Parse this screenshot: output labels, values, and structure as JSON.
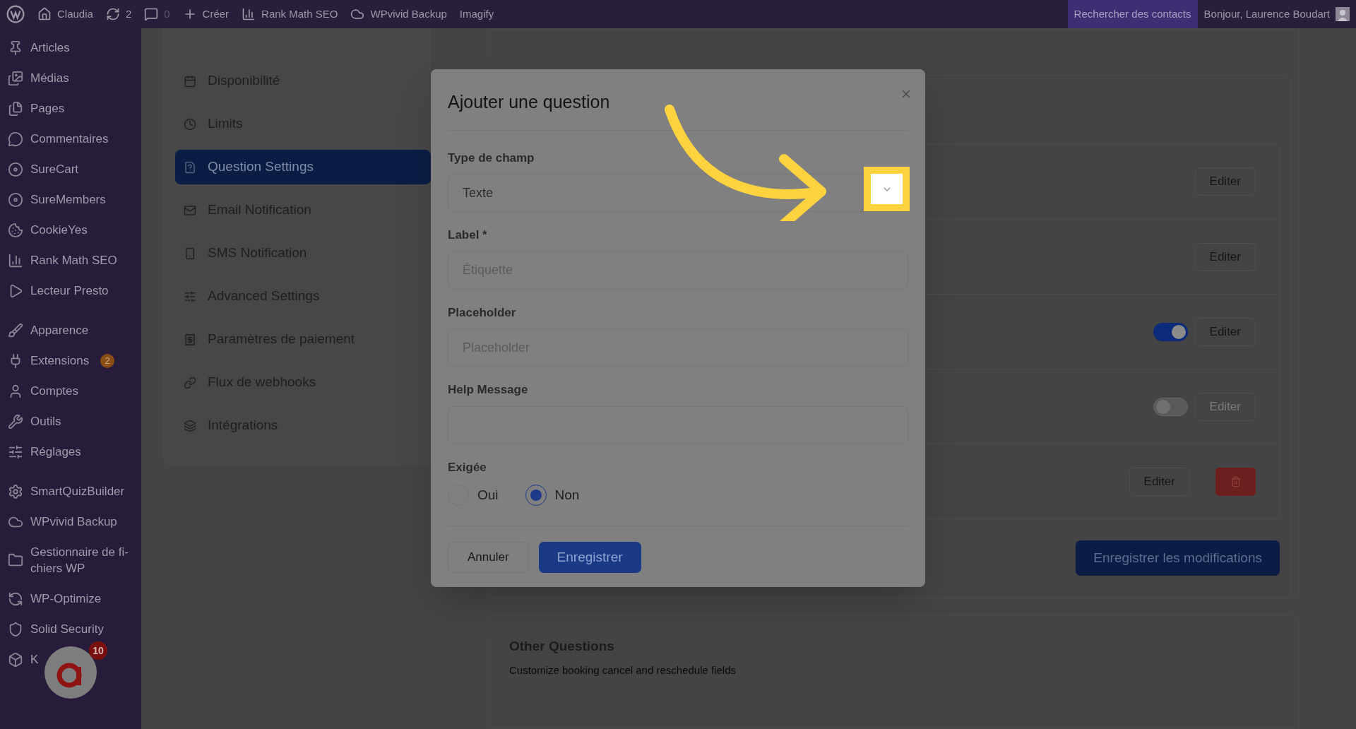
{
  "admin_bar": {
    "items": [
      {
        "label": "Claudia",
        "disabled": false
      },
      {
        "label": "2",
        "disabled": false
      },
      {
        "label": "0",
        "disabled": true
      },
      {
        "label": "Créer",
        "disabled": false
      },
      {
        "label": "Rank Math SEO",
        "disabled": false
      },
      {
        "label": "WPvivid Backup",
        "disabled": false
      },
      {
        "label": "Imagify",
        "disabled": false
      }
    ],
    "search": "Rechercher des contacts",
    "greeting": "Bonjour, Laurence Boudart"
  },
  "sidebar": {
    "groups": [
      [
        {
          "label": "Articles"
        },
        {
          "label": "Médias"
        },
        {
          "label": "Pages"
        },
        {
          "label": "Commentaires"
        },
        {
          "label": "SureCart"
        },
        {
          "label": "SureMembers"
        },
        {
          "label": "CookieYes"
        },
        {
          "label": "Rank Math SEO"
        },
        {
          "label": "Lecteur Presto"
        }
      ],
      [
        {
          "label": "Apparence"
        },
        {
          "label": "Extensions",
          "badge": "2"
        },
        {
          "label": "Comptes"
        },
        {
          "label": "Outils"
        },
        {
          "label": "Réglages"
        }
      ],
      [
        {
          "label": "SmartQuizBuilder"
        },
        {
          "label": "WPvivid Backup"
        },
        {
          "label": "Gestionnaire de fi-chiers WP"
        },
        {
          "label": "WP-Optimize"
        },
        {
          "label": "Solid Security"
        },
        {
          "label": "K"
        }
      ]
    ]
  },
  "chat_bubble": {
    "badge": "10"
  },
  "settings_nav": {
    "items": [
      {
        "label": "Disponibilité",
        "selected": false
      },
      {
        "label": "Limits",
        "selected": false
      },
      {
        "label": "Question Settings",
        "selected": true
      },
      {
        "label": "Email Notification",
        "selected": false
      },
      {
        "label": "SMS Notification",
        "selected": false
      },
      {
        "label": "Advanced Settings",
        "selected": false
      },
      {
        "label": "Paramètres de paiement",
        "selected": false
      },
      {
        "label": "Flux de webhooks",
        "selected": false
      },
      {
        "label": "Intégrations",
        "selected": false
      }
    ]
  },
  "question_rows": [
    {
      "kind": "edit",
      "button": "Editer"
    },
    {
      "kind": "edit",
      "button": "Editer"
    },
    {
      "kind": "toggle",
      "on": true,
      "disabled": false,
      "button": "Editer"
    },
    {
      "kind": "toggle",
      "on": false,
      "disabled": true,
      "button": "Editer"
    },
    {
      "kind": "delete",
      "button": "Editer"
    }
  ],
  "save_button": "Enregistrer les modifications",
  "other_questions": {
    "title": "Other Questions",
    "description": "Customize booking cancel and reschedule fields"
  },
  "modal": {
    "title": "Ajouter une question",
    "fields": [
      {
        "kind": "select",
        "label": "Type de champ",
        "value": "Texte"
      },
      {
        "kind": "input",
        "label": "Label *",
        "placeholder": "Étiquette"
      },
      {
        "kind": "input",
        "label": "Placeholder",
        "placeholder": "Placeholder"
      },
      {
        "kind": "input",
        "label": "Help Message"
      }
    ],
    "required": {
      "label": "Exigée",
      "options": [
        {
          "label": "Oui",
          "selected": false
        },
        {
          "label": "Non",
          "selected": true
        }
      ]
    },
    "cancel": "Annuler",
    "submit": "Enregistrer"
  }
}
